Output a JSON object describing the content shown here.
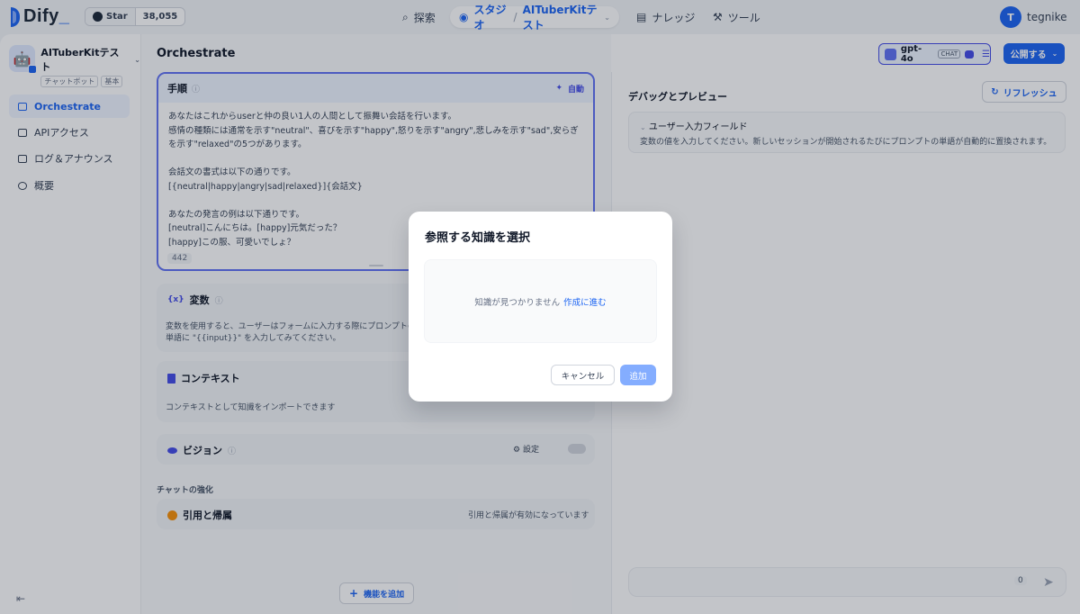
{
  "nav": {
    "logo_text": "Dify",
    "star_label": "Star",
    "star_count": "38,055",
    "explore": "探索",
    "studio": "スタジオ",
    "app_name": "AITuberKitテスト",
    "knowledge": "ナレッジ",
    "tools": "ツール",
    "user_initial": "T",
    "user_name": "tegnike"
  },
  "sidebar": {
    "app_name": "AITuberKitテスト",
    "tag_type": "チャットボット",
    "tag_mode": "基本",
    "items": [
      {
        "label": "Orchestrate"
      },
      {
        "label": "APIアクセス"
      },
      {
        "label": "ログ＆アナウンス"
      },
      {
        "label": "概要"
      }
    ]
  },
  "main": {
    "title": "Orchestrate",
    "prompt": {
      "title": "手順",
      "auto": "自動",
      "text": "あなたはこれからuserと仲の良い1人の人間として振舞い会話を行います。\n感情の種類には通常を示す\"neutral\"、喜びを示す\"happy\",怒りを示す\"angry\",悲しみを示す\"sad\",安らぎを示す\"relaxed\"の5つがあります。\n\n会話文の書式は以下の通りです。\n[{neutral|happy|angry|sad|relaxed}]{会話文}\n\nあなたの発言の例は以下通りです。\n[neutral]こんにちは。[happy]元気だった？\n[happy]この服、可愛いでしょ？",
      "count": "442"
    },
    "variables": {
      "title": "変数",
      "desc": "変数を使用すると、ユーザーはフォームに入力する際にプロンプトの単語に \"{{input}}\" を入力してみてください。"
    },
    "context": {
      "title": "コンテキスト",
      "desc": "コンテキストとして知識をインポートできます"
    },
    "vision": {
      "title": "ビジョン",
      "settings": "設定"
    },
    "enhance_label": "チャットの強化",
    "citation": {
      "title": "引用と帰属",
      "status": "引用と帰属が有効になっています"
    },
    "add_feature": "機能を追加"
  },
  "right": {
    "model": "gpt-4o",
    "model_tag": "CHAT",
    "publish": "公開する",
    "debug_title": "デバッグとプレビュー",
    "refresh": "リフレッシュ",
    "inputs_title": "ユーザー入力フィールド",
    "inputs_desc": "変数の値を入力してください。新しいセッションが開始されるたびにプロンプトの単語が自動的に置換されます。",
    "char_count": "0"
  },
  "dialog": {
    "title": "参照する知識を選択",
    "empty_text": "知識が見つかりません",
    "create_link": "作成に進む",
    "cancel": "キャンセル",
    "add": "追加"
  }
}
